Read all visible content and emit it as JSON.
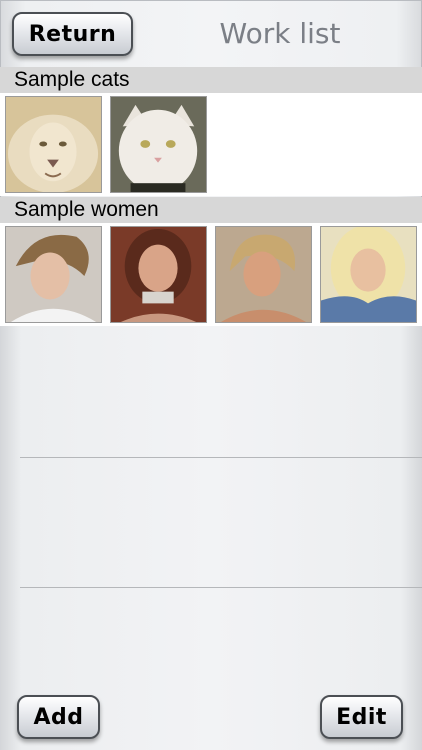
{
  "header": {
    "title": "Work list",
    "return_label": "Return"
  },
  "groups": [
    {
      "title": "Sample cats",
      "items": [
        "lion",
        "white-cat"
      ]
    },
    {
      "title": "Sample women",
      "items": [
        "woman-1",
        "woman-2",
        "woman-3",
        "woman-4"
      ]
    }
  ],
  "footer": {
    "add_label": "Add",
    "edit_label": "Edit"
  }
}
